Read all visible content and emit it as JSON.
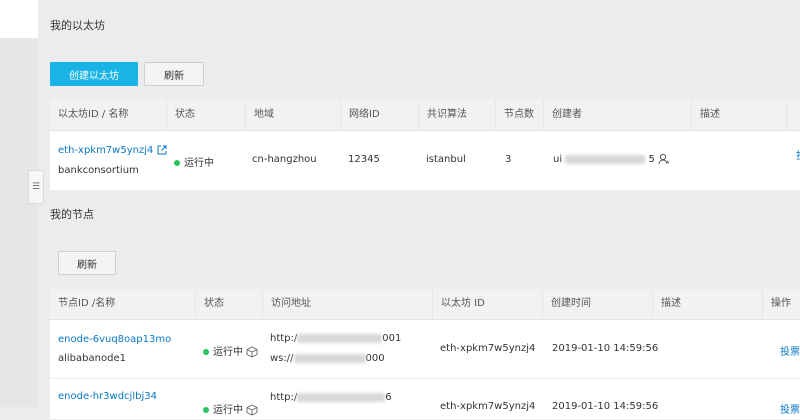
{
  "ethereum_section": {
    "title": "我的以太坊",
    "create_button": "创建以太坊",
    "refresh_button": "刷新",
    "columns": [
      "以太坊ID / 名称",
      "状态",
      "地域",
      "网络ID",
      "共识算法",
      "节点数",
      "创建者",
      "描述"
    ],
    "rows": [
      {
        "id": "eth-xpkm7w5ynzj4",
        "name": "bankconsortium",
        "status": "运行中",
        "region": "cn-hangzhou",
        "network_id": "12345",
        "consensus": "istanbul",
        "node_count": "3",
        "creator_prefix": "ui",
        "creator_suffix": "5",
        "description": "",
        "action_partial": "投"
      }
    ]
  },
  "node_section": {
    "title": "我的节点",
    "refresh_button": "刷新",
    "columns": [
      "节点ID /名称",
      "状态",
      "访问地址",
      "以太坊 ID",
      "创建时间",
      "描述",
      "操作"
    ],
    "rows": [
      {
        "id": "enode-6vuq8oap13mo",
        "name": "alibabanode1",
        "status": "运行中",
        "address_http_prefix": "http:/",
        "address_http_suffix": "001",
        "address_ws_prefix": "ws://",
        "address_ws_suffix": "000",
        "ethereum_id": "eth-xpkm7w5ynzj4",
        "created": "2019-01-10 14:59:56",
        "description": "",
        "action": "投票"
      },
      {
        "id": "enode-hr3wdcjlbj34",
        "name": "",
        "status": "运行中",
        "address_http_prefix": "http:/",
        "address_http_suffix": "6",
        "ethereum_id": "eth-xpkm7w5ynzj4",
        "created": "2019-01-10 14:59:56",
        "action": "投票"
      }
    ]
  },
  "colors": {
    "accent": "#19b4e6",
    "link": "#0a78c8",
    "running": "#28c35a"
  }
}
